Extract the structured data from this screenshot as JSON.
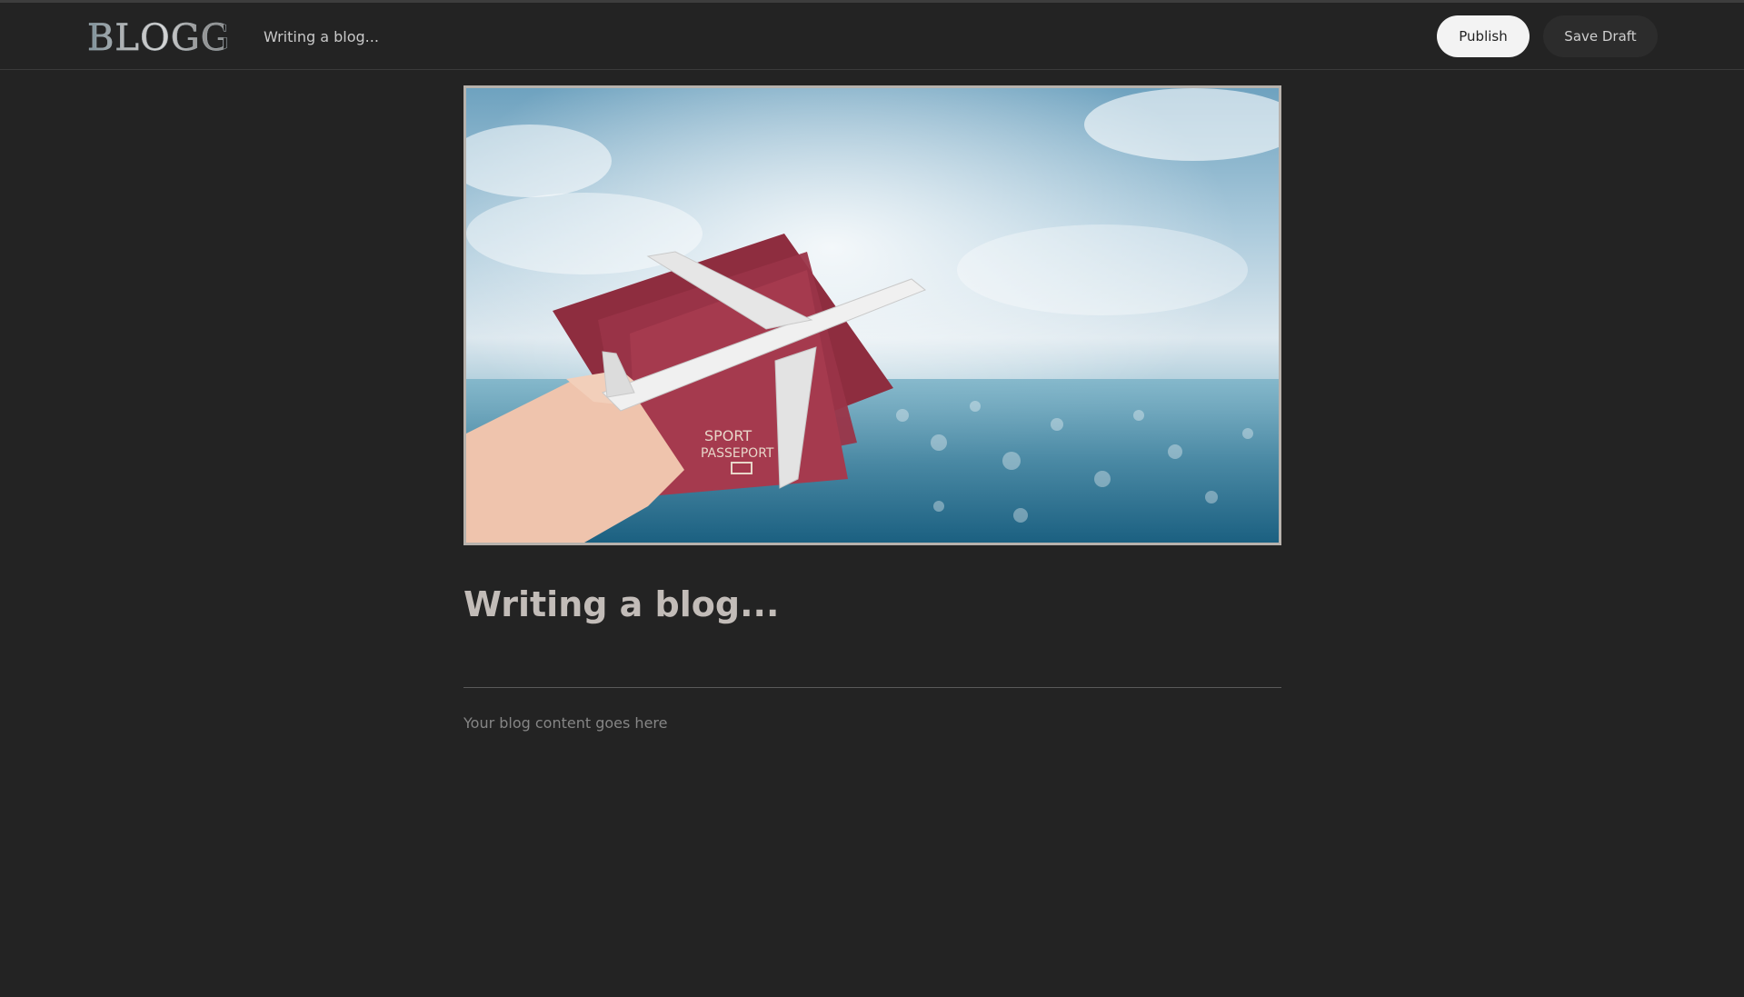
{
  "header": {
    "logo_text": "BLOGG",
    "title": "Writing a blog...",
    "publish_label": "Publish",
    "save_draft_label": "Save Draft"
  },
  "cover_image": {
    "passport_text_1": "SPORT",
    "passport_text_2": "PASSEPORT"
  },
  "post": {
    "title": "Writing a blog...",
    "content_placeholder": "Your blog content goes here"
  },
  "colors": {
    "background": "#232323",
    "publish_bg": "#f3f3f3",
    "draft_bg": "#2c2c2c",
    "title_text": "#c2bcb8"
  }
}
